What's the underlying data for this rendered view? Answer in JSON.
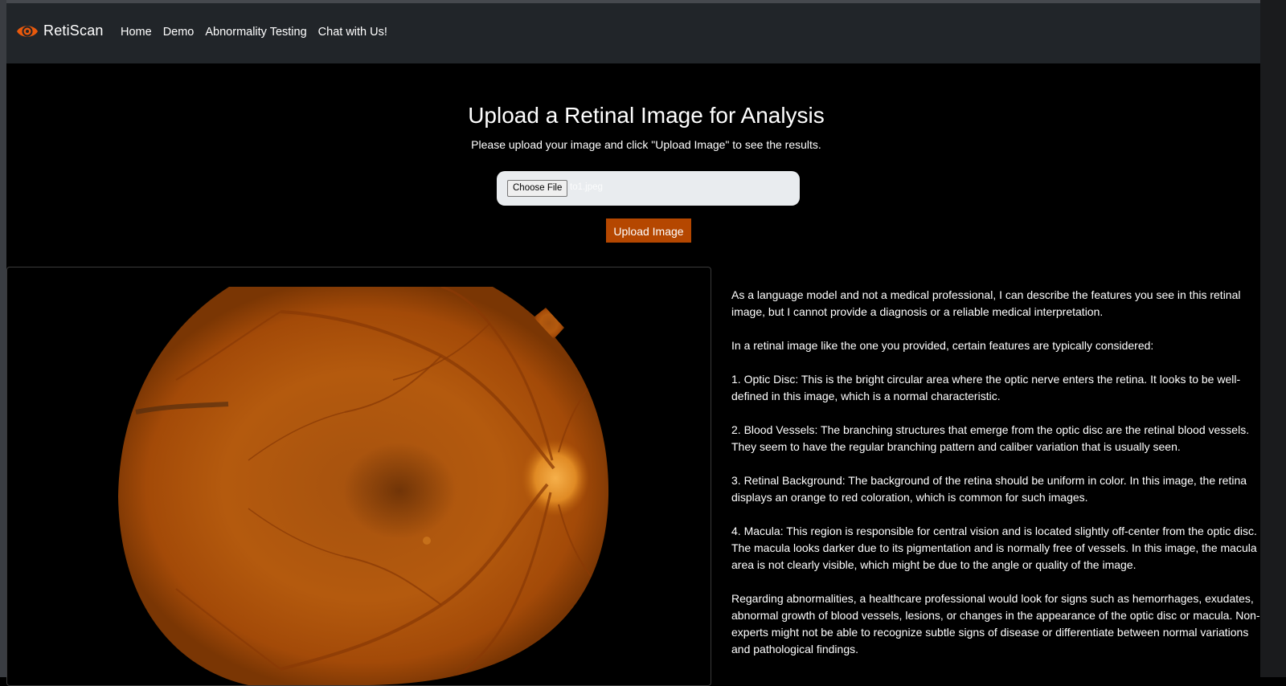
{
  "navbar": {
    "brand": "RetiScan",
    "links": [
      "Home",
      "Demo",
      "Abnormality Testing",
      "Chat with Us!"
    ]
  },
  "main": {
    "title": "Upload a Retinal Image for Analysis",
    "subtitle": "Please upload your image and click \"Upload Image\" to see the results.",
    "file_button_label": "Choose File",
    "file_name": "to1.jpeg",
    "upload_button_label": "Upload Image"
  },
  "analysis": {
    "paragraphs": [
      "As a language model and not a medical professional, I can describe the features you see in this retinal image, but I cannot provide a diagnosis or a reliable medical interpretation.",
      "In a retinal image like the one you provided, certain features are typically considered:",
      "1. Optic Disc: This is the bright circular area where the optic nerve enters the retina. It looks to be well-defined in this image, which is a normal characteristic.",
      "2. Blood Vessels: The branching structures that emerge from the optic disc are the retinal blood vessels. They seem to have the regular branching pattern and caliber variation that is usually seen.",
      "3. Retinal Background: The background of the retina should be uniform in color. In this image, the retina displays an orange to red coloration, which is common for such images.",
      "4. Macula: This region is responsible for central vision and is located slightly off-center from the optic disc. The macula looks darker due to its pigmentation and is normally free of vessels. In this image, the macula area is not clearly visible, which might be due to the angle or quality of the image.",
      "Regarding abnormalities, a healthcare professional would look for signs such as hemorrhages, exudates, abnormal growth of blood vessels, lesions, or changes in the appearance of the optic disc or macula. Non-experts might not be able to recognize subtle signs of disease or differentiate between normal variations and pathological findings."
    ]
  },
  "colors": {
    "navbar_bg": "#212529",
    "accent": "#b54700",
    "brand_icon": "#e8590c"
  },
  "icons": {
    "brand": "eye-icon"
  }
}
